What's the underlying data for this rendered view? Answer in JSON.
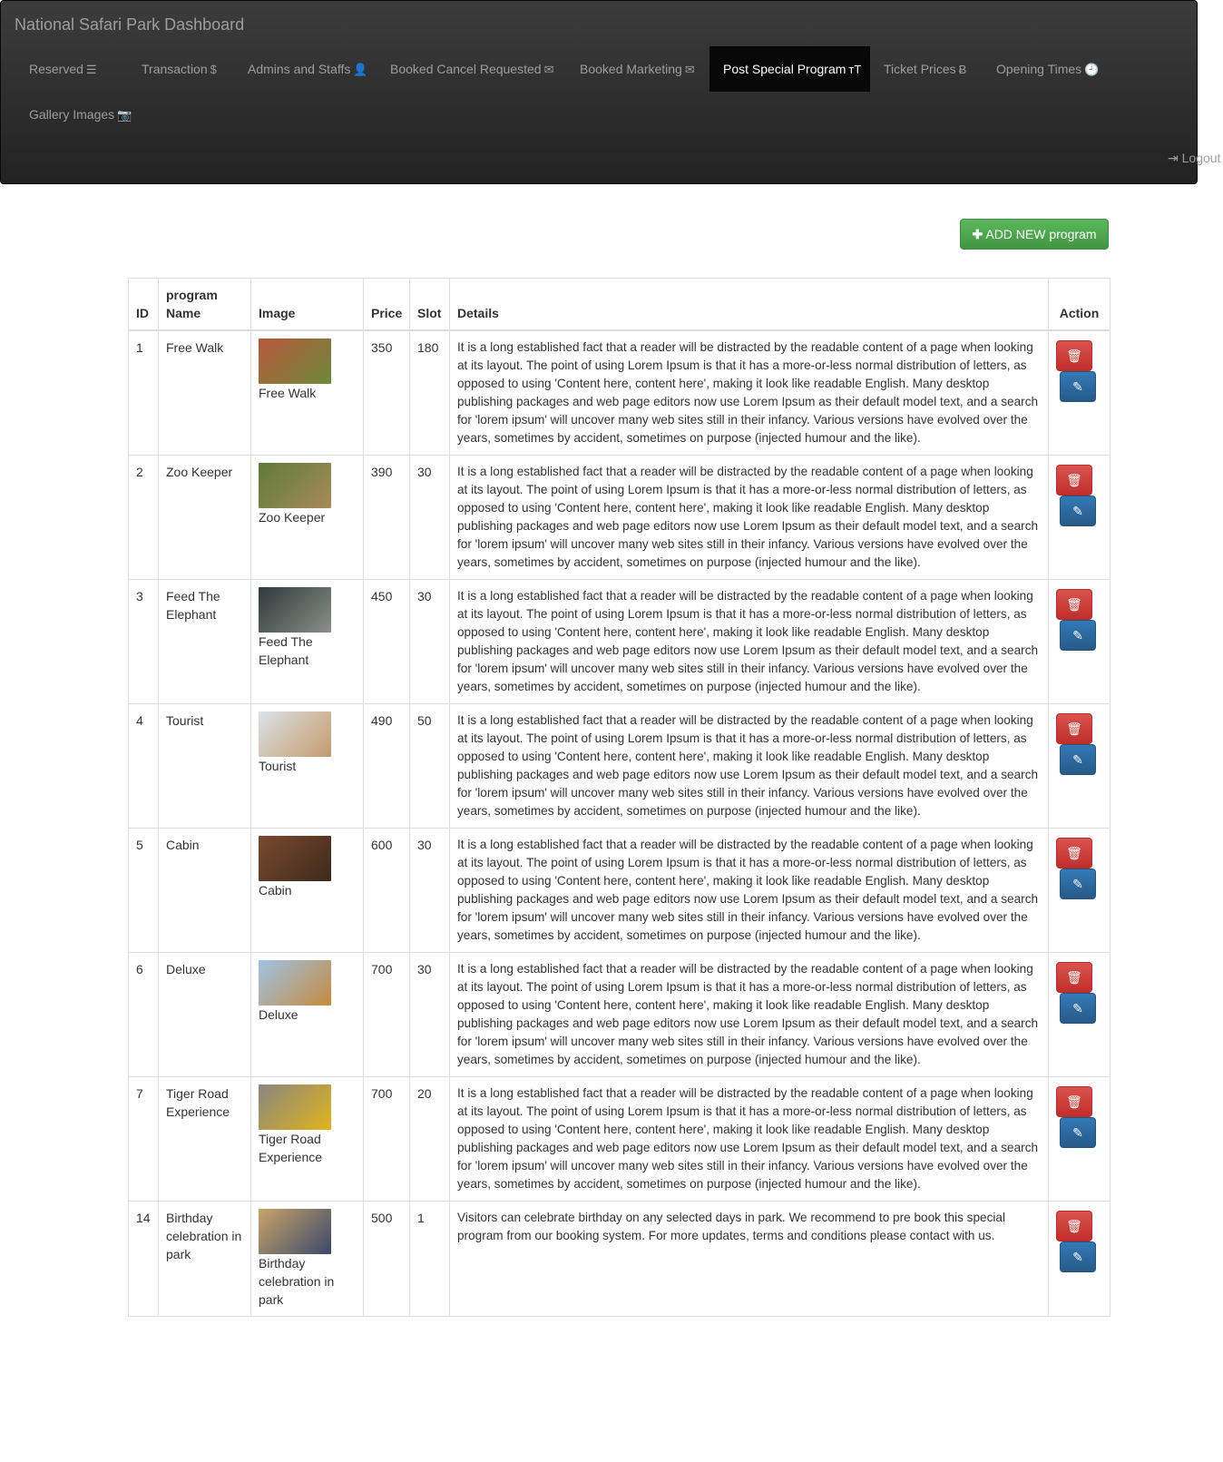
{
  "header": {
    "title": "National Safari Park Dashboard",
    "nav": [
      {
        "label": "Reserved",
        "icon": "list-icon",
        "glyph": "☰"
      },
      {
        "label": "Transaction",
        "icon": "dollar-icon",
        "glyph": "$"
      },
      {
        "label": "Admins and Staffs",
        "icon": "user-icon",
        "glyph": "👤"
      },
      {
        "label": "Booked Cancel Requested",
        "icon": "envelope-icon",
        "glyph": "✉"
      },
      {
        "label": "Booked Marketing",
        "icon": "envelope-icon",
        "glyph": "✉"
      },
      {
        "label": "Post Special Program",
        "icon": "text-size-icon",
        "glyph": "ᴛT"
      },
      {
        "label": "Ticket Prices",
        "icon": "bitcoin-icon",
        "glyph": "Ƀ"
      },
      {
        "label": "Opening Times",
        "icon": "clock-icon",
        "glyph": "🕘"
      },
      {
        "label": "Gallery Images",
        "icon": "camera-icon",
        "glyph": "📷"
      }
    ],
    "active": "Post Special Program",
    "logout_label": "Logout"
  },
  "add_button_label": "ADD NEW program",
  "table": {
    "headers": [
      "ID",
      "program Name",
      "Image",
      "Price",
      "Slot",
      "Details",
      "Action"
    ],
    "rows": [
      {
        "id": "1",
        "name": "Free Walk",
        "caption": "Free Walk",
        "price": "350",
        "slot": "180",
        "details": "It is a long established fact that a reader will be distracted by the readable content of a page when looking at its layout. The point of using Lorem Ipsum is that it has a more-or-less normal distribution of letters, as opposed to using 'Content here, content here', making it look like readable English. Many desktop publishing packages and web page editors now use Lorem Ipsum as their default model text, and a search for 'lorem ipsum' will uncover many web sites still in their infancy. Various versions have evolved over the years, sometimes by accident, sometimes on purpose (injected humour and the like).",
        "img": [
          "#b8573a",
          "#6d8a3a"
        ]
      },
      {
        "id": "2",
        "name": "Zoo Keeper",
        "caption": "Zoo Keeper",
        "price": "390",
        "slot": "30",
        "details": "It is a long established fact that a reader will be distracted by the readable content of a page when looking at its layout. The point of using Lorem Ipsum is that it has a more-or-less normal distribution of letters, as opposed to using 'Content here, content here', making it look like readable English. Many desktop publishing packages and web page editors now use Lorem Ipsum as their default model text, and a search for 'lorem ipsum' will uncover many web sites still in their infancy. Various versions have evolved over the years, sometimes by accident, sometimes on purpose (injected humour and the like).",
        "img": [
          "#5f7a3a",
          "#a88b5a"
        ]
      },
      {
        "id": "3",
        "name": "Feed The Elephant",
        "caption": "Feed The Elephant",
        "price": "450",
        "slot": "30",
        "details": "It is a long established fact that a reader will be distracted by the readable content of a page when looking at its layout. The point of using Lorem Ipsum is that it has a more-or-less normal distribution of letters, as opposed to using 'Content here, content here', making it look like readable English. Many desktop publishing packages and web page editors now use Lorem Ipsum as their default model text, and a search for 'lorem ipsum' will uncover many web sites still in their infancy. Various versions have evolved over the years, sometimes by accident, sometimes on purpose (injected humour and the like).",
        "img": [
          "#2f3a3a",
          "#8a8f88"
        ]
      },
      {
        "id": "4",
        "name": "Tourist",
        "caption": "Tourist",
        "price": "490",
        "slot": "50",
        "details": "It is a long established fact that a reader will be distracted by the readable content of a page when looking at its layout. The point of using Lorem Ipsum is that it has a more-or-less normal distribution of letters, as opposed to using 'Content here, content here', making it look like readable English. Many desktop publishing packages and web page editors now use Lorem Ipsum as their default model text, and a search for 'lorem ipsum' will uncover many web sites still in their infancy. Various versions have evolved over the years, sometimes by accident, sometimes on purpose (injected humour and the like).",
        "img": [
          "#dce3e8",
          "#c49a6c"
        ]
      },
      {
        "id": "5",
        "name": "Cabin",
        "caption": "Cabin",
        "price": "600",
        "slot": "30",
        "details": "It is a long established fact that a reader will be distracted by the readable content of a page when looking at its layout. The point of using Lorem Ipsum is that it has a more-or-less normal distribution of letters, as opposed to using 'Content here, content here', making it look like readable English. Many desktop publishing packages and web page editors now use Lorem Ipsum as their default model text, and a search for 'lorem ipsum' will uncover many web sites still in their infancy. Various versions have evolved over the years, sometimes by accident, sometimes on purpose (injected humour and the like).",
        "img": [
          "#7a4a2e",
          "#3d2a1c"
        ]
      },
      {
        "id": "6",
        "name": "Deluxe",
        "caption": "Deluxe",
        "price": "700",
        "slot": "30",
        "details": "It is a long established fact that a reader will be distracted by the readable content of a page when looking at its layout. The point of using Lorem Ipsum is that it has a more-or-less normal distribution of letters, as opposed to using 'Content here, content here', making it look like readable English. Many desktop publishing packages and web page editors now use Lorem Ipsum as their default model text, and a search for 'lorem ipsum' will uncover many web sites still in their infancy. Various versions have evolved over the years, sometimes by accident, sometimes on purpose (injected humour and the like).",
        "img": [
          "#9fc3e6",
          "#c58a3e"
        ]
      },
      {
        "id": "7",
        "name": "Tiger Road Experience",
        "caption": "Tiger Road Experience",
        "price": "700",
        "slot": "20",
        "details": "It is a long established fact that a reader will be distracted by the readable content of a page when looking at its layout. The point of using Lorem Ipsum is that it has a more-or-less normal distribution of letters, as opposed to using 'Content here, content here', making it look like readable English. Many desktop publishing packages and web page editors now use Lorem Ipsum as their default model text, and a search for 'lorem ipsum' will uncover many web sites still in their infancy. Various versions have evolved over the years, sometimes by accident, sometimes on purpose (injected humour and the like).",
        "img": [
          "#8a8680",
          "#e0b41a"
        ]
      },
      {
        "id": "14",
        "name": "Birthday celebration in park",
        "caption": "Birthday celebration in park",
        "price": "500",
        "slot": "1",
        "details": "Visitors can celebrate birthday on any selected days in park. We recommend to pre book this special program from our booking system. For more updates, terms and conditions please contact with us.",
        "img": [
          "#c9a36a",
          "#3a4a6a"
        ]
      }
    ]
  },
  "colors": {
    "navbar": "#222222",
    "active_nav": "#080808",
    "add_button": "#5cb85c",
    "delete_button": "#d9534f",
    "edit_button": "#337ab7"
  }
}
